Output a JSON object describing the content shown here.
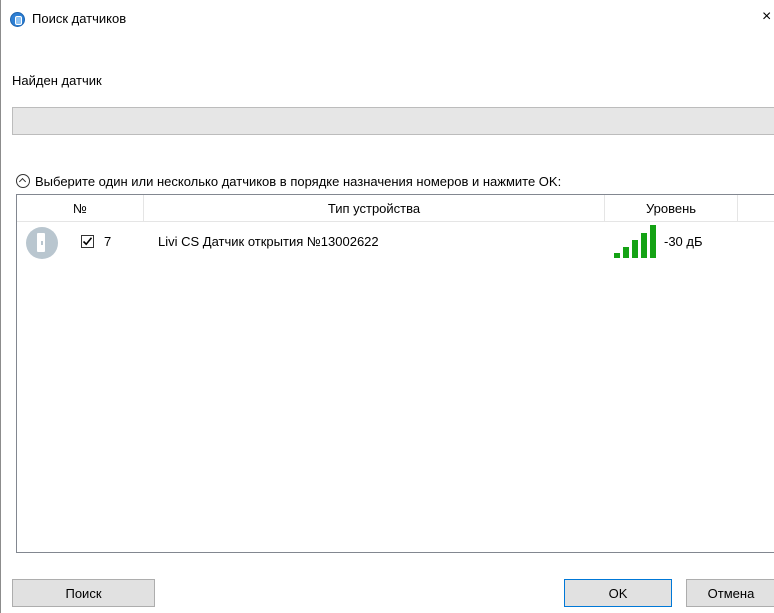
{
  "window": {
    "title": "Поиск датчиков",
    "close_glyph": "×"
  },
  "status": {
    "found_text": "Найден датчик",
    "progress": 0
  },
  "selection": {
    "instruction": "Выберите один или несколько датчиков в порядке назначения номеров и нажмите OK:"
  },
  "table": {
    "columns": {
      "number": "№",
      "type": "Тип устройства",
      "level": "Уровень"
    },
    "rows": [
      {
        "icon": "door-sensor-icon",
        "checked": true,
        "number": "7",
        "type": "Livi CS Датчик открытия №13002622",
        "signal_bars": 5,
        "level": "-30 дБ"
      }
    ]
  },
  "buttons": {
    "search": "Поиск",
    "ok": "OK",
    "cancel": "Отмена"
  },
  "colors": {
    "signal": "#14a214",
    "ok_border": "#0078d7",
    "button_bg": "#e1e1e1"
  }
}
